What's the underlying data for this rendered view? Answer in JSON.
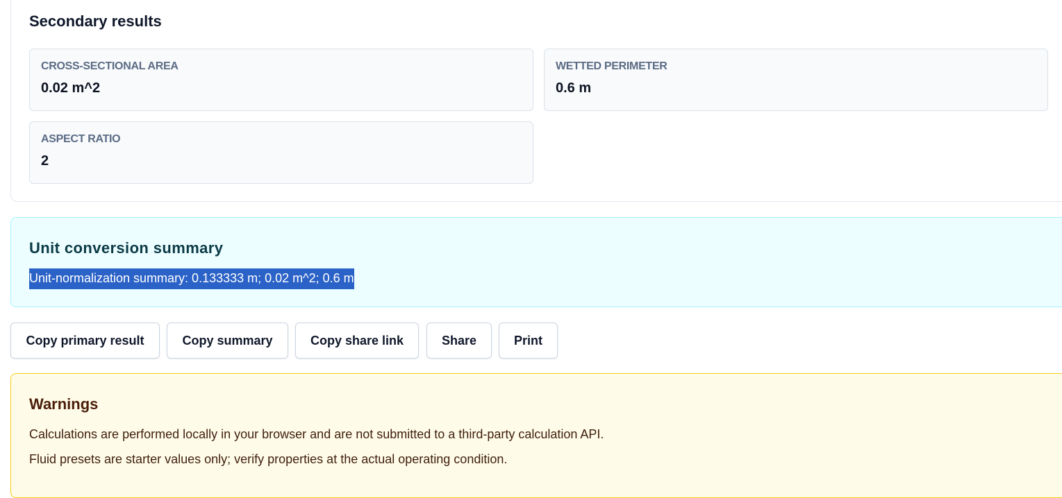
{
  "secondary": {
    "title": "Secondary results",
    "metrics": [
      {
        "label": "CROSS-SECTIONAL AREA",
        "value": "0.02 m^2"
      },
      {
        "label": "WETTED PERIMETER",
        "value": "0.6 m"
      },
      {
        "label": "ASPECT RATIO",
        "value": "2"
      }
    ]
  },
  "unit_conversion": {
    "title": "Unit conversion summary",
    "summary": "Unit-normalization summary: 0.133333 m; 0.02 m^2; 0.6 m"
  },
  "actions": {
    "copy_primary": "Copy primary result",
    "copy_summary": "Copy summary",
    "copy_share_link": "Copy share link",
    "share": "Share",
    "print": "Print"
  },
  "warnings": {
    "title": "Warnings",
    "items": [
      "Calculations are performed locally in your browser and are not submitted to a third-party calculation API.",
      "Fluid presets are starter values only; verify properties at the actual operating condition."
    ]
  },
  "colors": {
    "unit_panel_bg": "#ecfeff",
    "warning_panel_bg": "#fefce8",
    "selection_highlight": "#2b62c7"
  }
}
